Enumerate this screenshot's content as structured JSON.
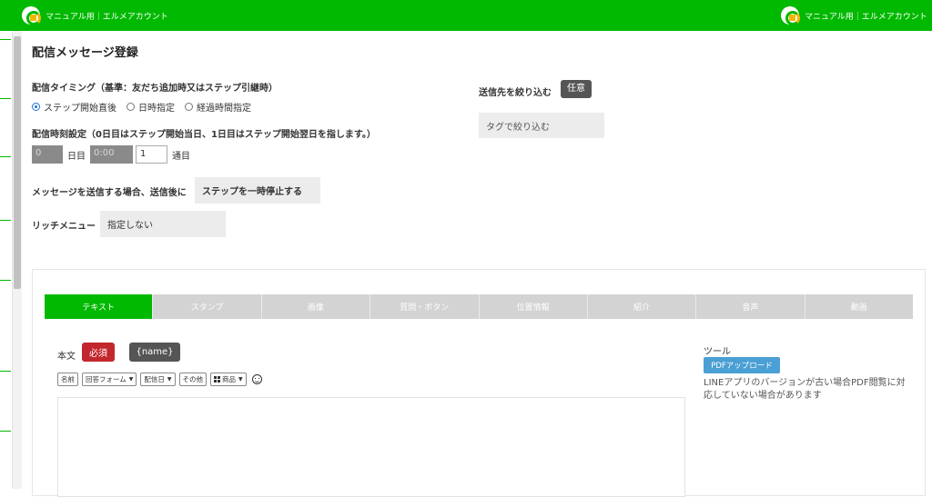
{
  "header": {
    "account_left": "マニュアル用｜エルメアカウント",
    "account_right": "マニュアル用｜エルメアカウント"
  },
  "page": {
    "title": "配信メッセージ登録"
  },
  "timing": {
    "label": "配信タイミング（基準：友だち追加時又はステップ引継時）",
    "options": [
      "ステップ開始直後",
      "日時指定",
      "経過時間指定"
    ],
    "selected": "ステップ開始直後"
  },
  "schedule": {
    "label": "配信時刻設定（0日目はステップ開始当日、1日目はステップ開始翌日を指します。）",
    "day_value": "0",
    "day_unit": "日目",
    "time_value": "0:00",
    "count_value": "1",
    "count_unit": "通目"
  },
  "after_send": {
    "label": "メッセージを送信する場合、送信後に",
    "value": "ステップを一時停止する"
  },
  "rich_menu": {
    "label": "リッチメニュー",
    "value": "指定しない"
  },
  "narrow": {
    "label": "送信先を絞り込む",
    "badge": "任意",
    "tag_placeholder": "タグで絞り込む"
  },
  "tabs": [
    "テキスト",
    "スタンプ",
    "画像",
    "質問・ボタン",
    "位置情報",
    "紹介",
    "音声",
    "動画"
  ],
  "active_tab": "テキスト",
  "editor": {
    "body_label": "本文",
    "required_badge": "必須",
    "name_button": "{name}",
    "toolbar": {
      "name": "名前",
      "answer_form": "回答フォーム",
      "delivery_day": "配信日",
      "other": "その他",
      "product": "商品"
    }
  },
  "tool": {
    "title": "ツール",
    "pdf_button": "PDFアップロード",
    "note": "LINEアプリのバージョンが古い場合PDF閲覧に対応していない場合があります"
  },
  "colors": {
    "brand_green": "#00b900",
    "required_red": "#c2272d",
    "pdf_blue": "#4a9fd4"
  }
}
